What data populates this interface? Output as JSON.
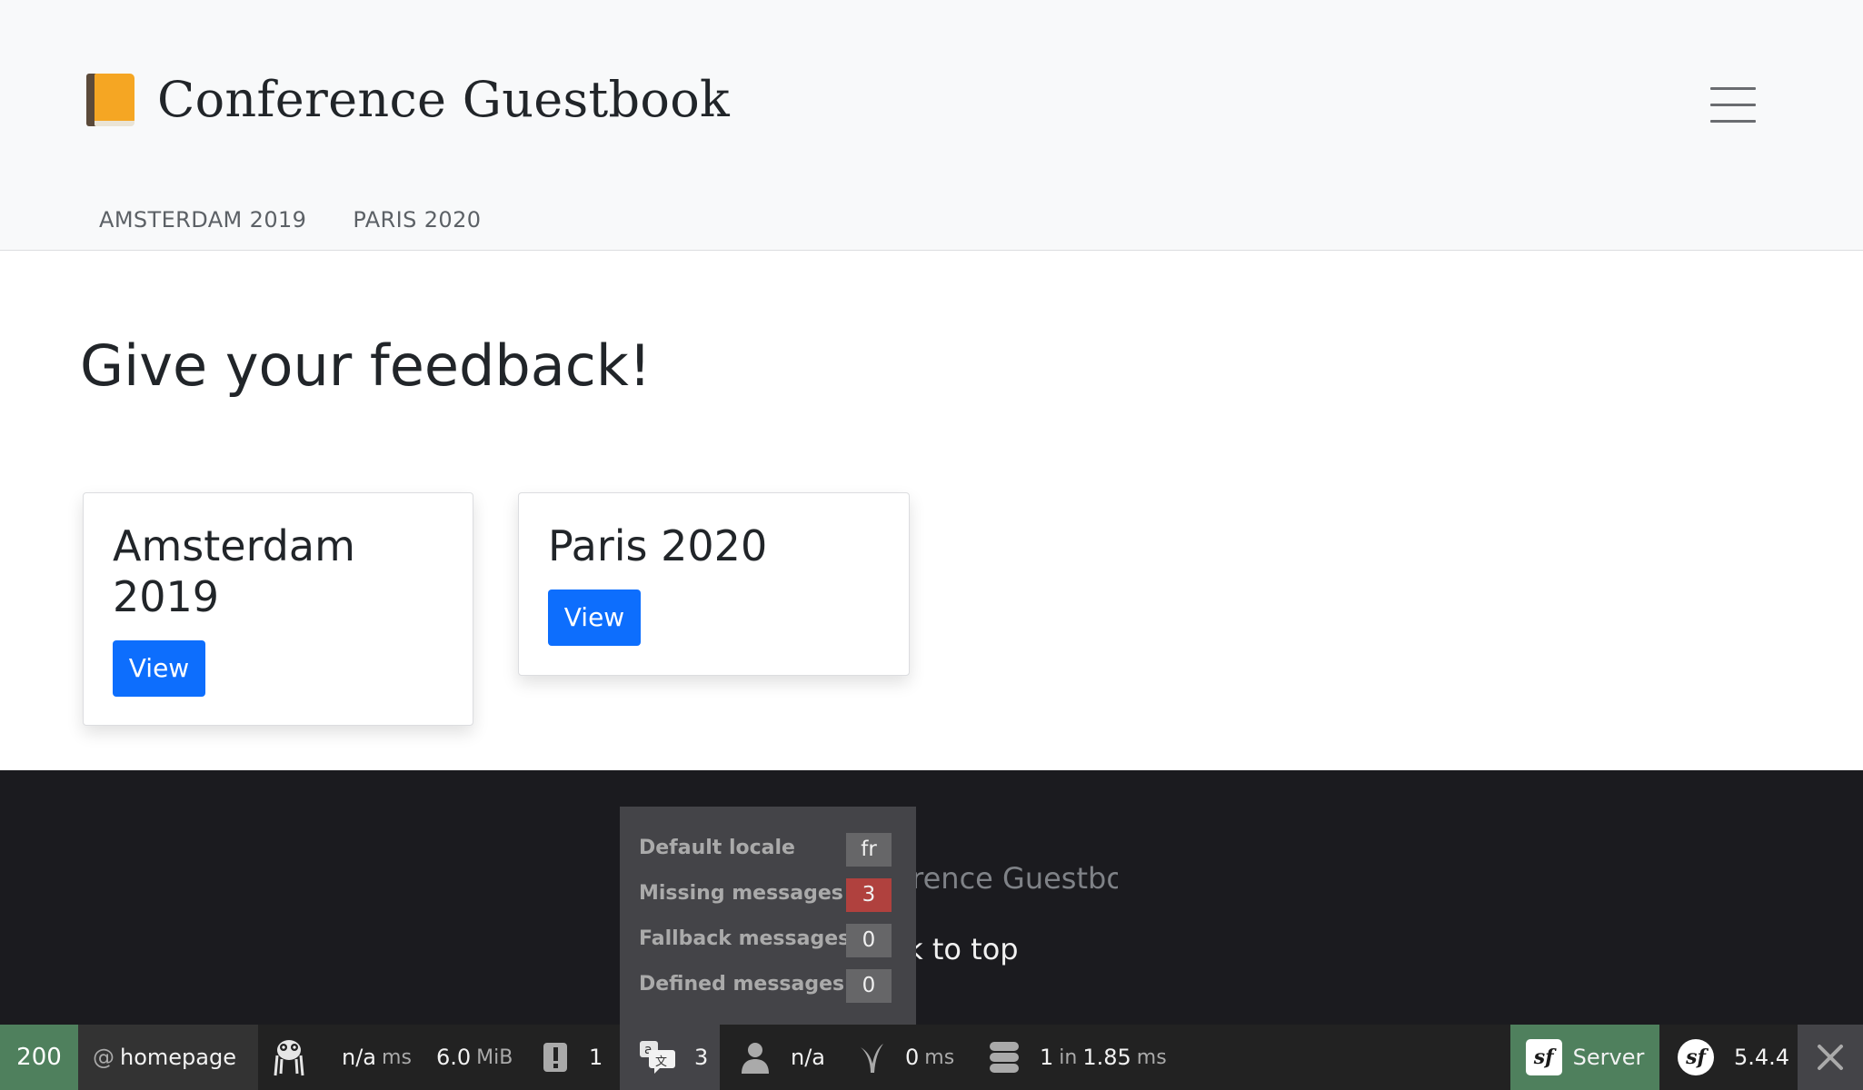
{
  "header": {
    "brand_emoji": "book-icon",
    "brand_title": "Conference Guestbook",
    "menu_icon": "hamburger-icon",
    "nav": [
      {
        "label": "AMSTERDAM 2019"
      },
      {
        "label": "PARIS 2020"
      }
    ]
  },
  "main": {
    "title": "Give your feedback!",
    "cards": [
      {
        "title": "Amsterdam 2019",
        "button": "View"
      },
      {
        "title": "Paris 2020",
        "button": "View"
      }
    ]
  },
  "footer": {
    "brand_text": "Conference Guestbook",
    "back_to_top": "Back to top"
  },
  "translation_panel": {
    "rows": [
      {
        "label": "Default locale",
        "value": "fr",
        "status": "normal"
      },
      {
        "label": "Missing messages",
        "value": "3",
        "status": "error"
      },
      {
        "label": "Fallback messages",
        "value": "0",
        "status": "normal"
      },
      {
        "label": "Defined messages",
        "value": "0",
        "status": "normal"
      }
    ]
  },
  "toolbar": {
    "status_code": "200",
    "route_prefix": "@",
    "route": "homepage",
    "ghost_icon": "ghost-icon",
    "time_value": "n/a",
    "time_unit": "ms",
    "memory_value": "6.0",
    "memory_unit": "MiB",
    "log_count": "1",
    "translation_count": "3",
    "user_value": "n/a",
    "twig_value": "0",
    "twig_unit": "ms",
    "db_queries": "1",
    "db_in": "in",
    "db_time": "1.85",
    "db_unit": "ms",
    "server_label": "Server",
    "version": "5.4.4",
    "colors": {
      "status_ok": "#4f805d",
      "error": "#b0413e",
      "bar": "#222222",
      "active": "#444448"
    }
  },
  "colors": {
    "primary": "#0d6efd",
    "header_bg": "#f8f9fa",
    "footer_bg": "#1b1b1f",
    "book_cover": "#f5a623"
  }
}
